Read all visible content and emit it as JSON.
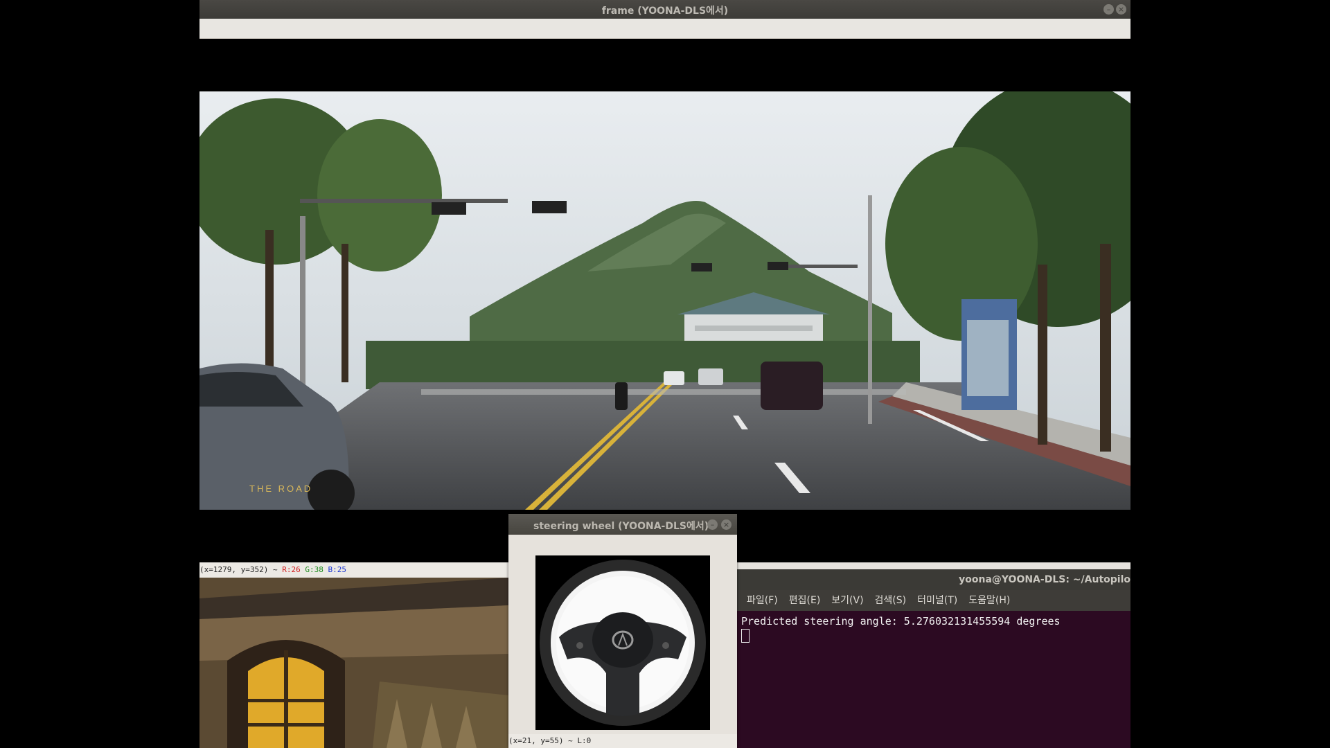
{
  "frame_window": {
    "title": "frame (YOONA-DLS에서)",
    "video_watermark": "THE ROAD"
  },
  "image_window": {
    "status": {
      "coords": "(x=1279, y=352) ~",
      "r": "R:26",
      "g": "G:38",
      "b": "B:25"
    }
  },
  "steering_window": {
    "title": "steering wheel (YOONA-DLS에서)",
    "status": "(x=21, y=55) ~ L:0"
  },
  "terminal_window": {
    "title": "yoona@YOONA-DLS: ~/Autopilo",
    "menu": [
      "파일(F)",
      "편집(E)",
      "보기(V)",
      "검색(S)",
      "터미널(T)",
      "도움말(H)"
    ],
    "output_line": "Predicted steering angle: 5.276032131455594 degrees"
  },
  "colors": {
    "titlebar": "#3c3b37",
    "terminal_bg": "#2c0a22",
    "window_bg": "#e6e2dc"
  }
}
